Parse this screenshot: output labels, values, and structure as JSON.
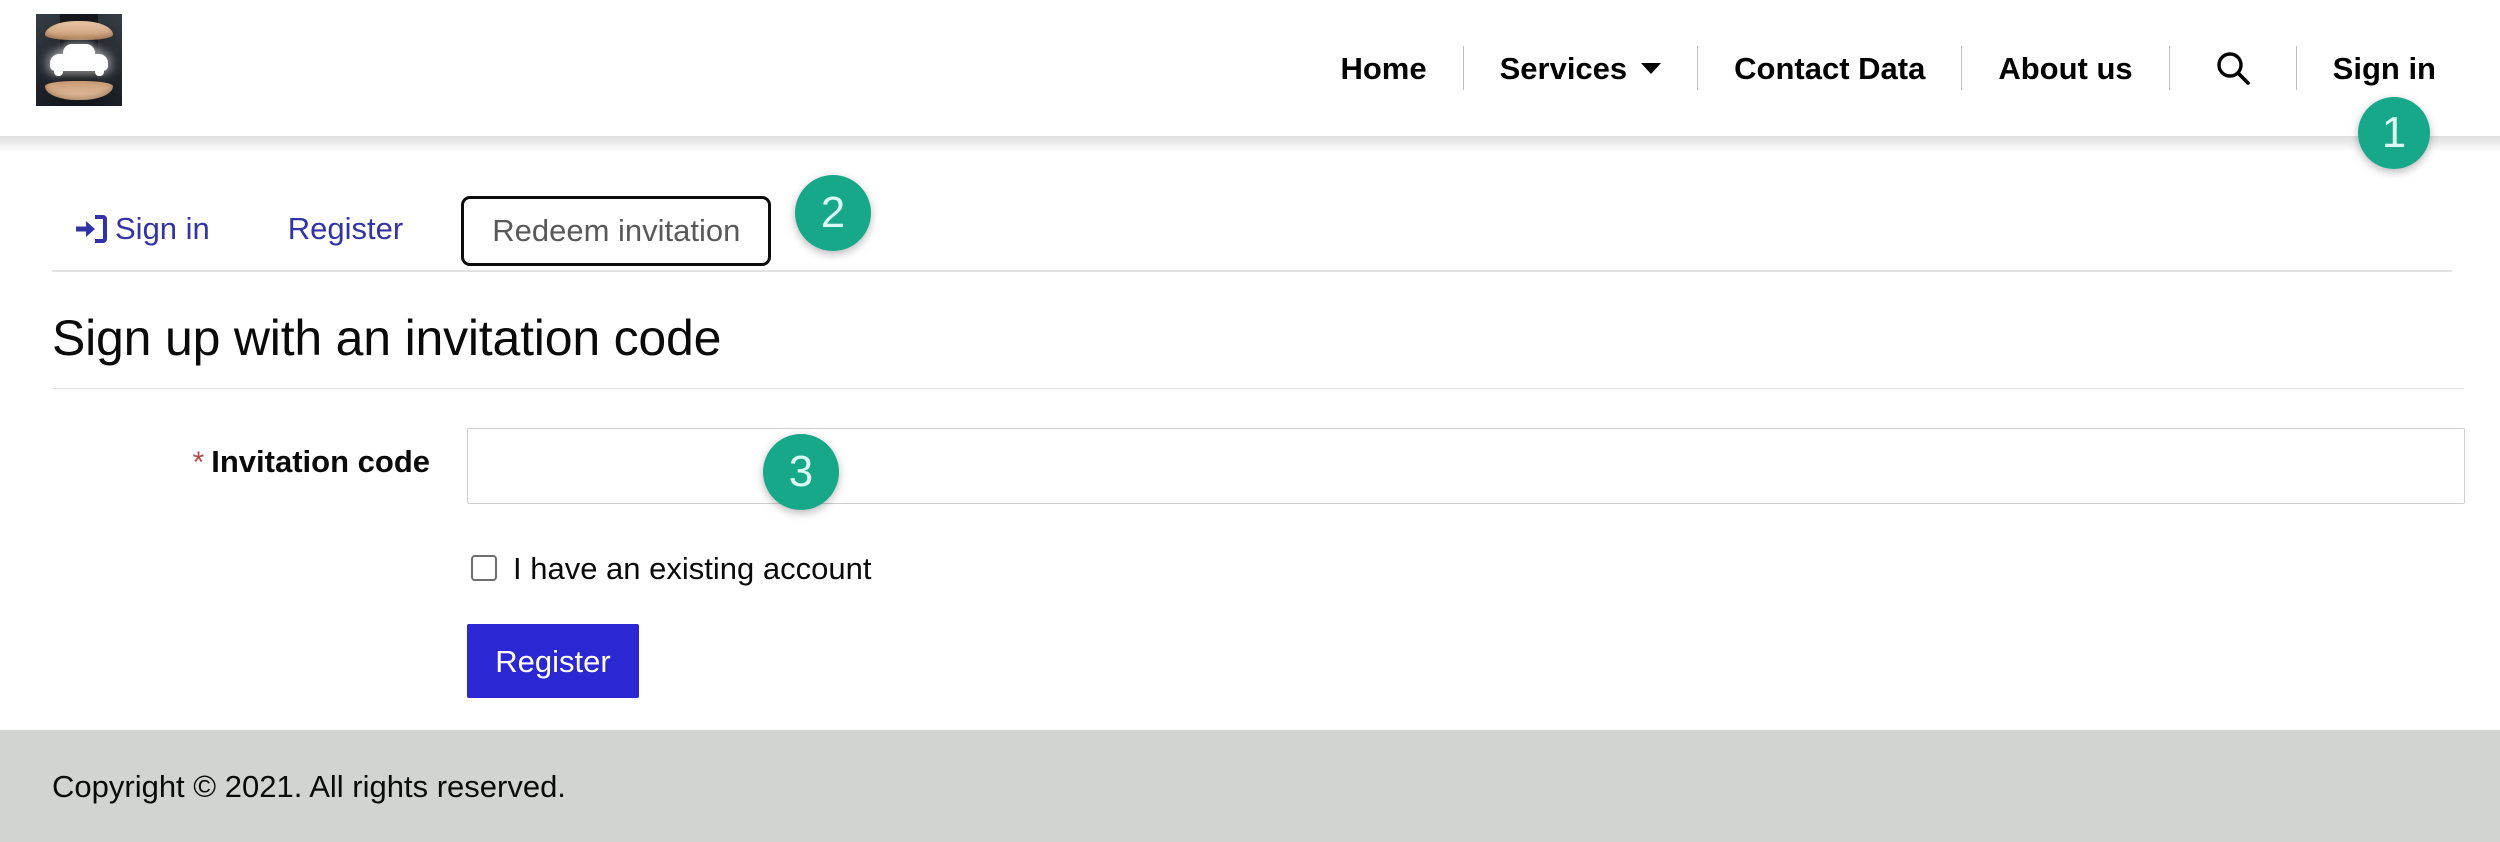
{
  "header": {
    "logo_alt": "Hands protecting a car",
    "nav": [
      {
        "label": "Home",
        "icon": null,
        "has_caret": false
      },
      {
        "label": "Services",
        "icon": null,
        "has_caret": true
      },
      {
        "label": "Contact Data",
        "icon": null,
        "has_caret": false
      },
      {
        "label": "About us",
        "icon": null,
        "has_caret": false
      },
      {
        "label": "",
        "icon": "search-icon",
        "has_caret": false
      },
      {
        "label": "Sign in",
        "icon": null,
        "has_caret": false
      }
    ]
  },
  "tabs": {
    "signin": "Sign in",
    "signin_icon": "sign-in-icon",
    "register": "Register",
    "redeem": "Redeem invitation",
    "active": "Redeem invitation"
  },
  "main": {
    "title": "Sign up with an invitation code",
    "field": {
      "required_mark": "*",
      "label": "Invitation code",
      "value": "",
      "placeholder": ""
    },
    "checkbox": {
      "label": "I have an existing account",
      "checked": false
    },
    "submit_label": "Register"
  },
  "footer": {
    "copyright": "Copyright © 2021. All rights reserved."
  },
  "markers": {
    "one": "1",
    "two": "2",
    "three": "3"
  },
  "colors": {
    "marker": "#16a889",
    "link": "#3333a8",
    "button": "#2b27d2",
    "required": "#b34a4a",
    "footer_bg": "#d2d4d1"
  }
}
